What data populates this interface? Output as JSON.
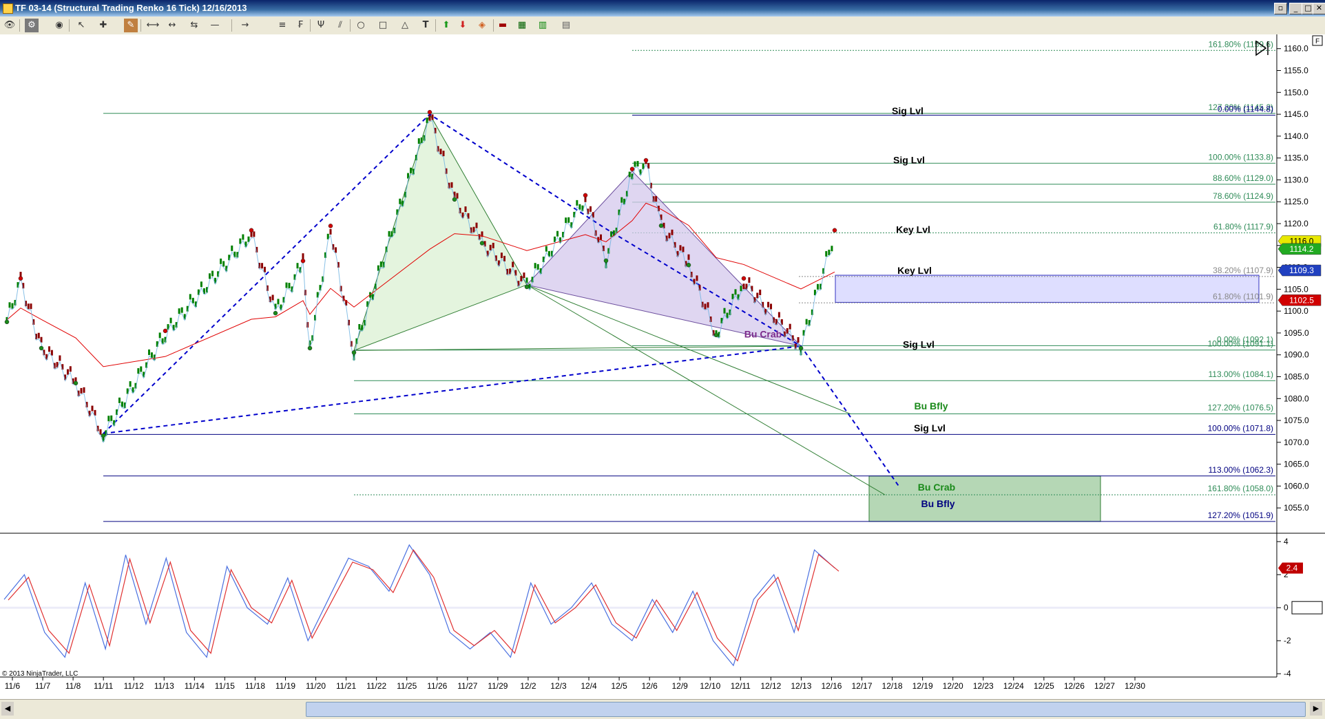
{
  "window": {
    "title": "TF 03-14 (Structural Trading Renko 16 Tick)  12/16/2013"
  },
  "copyright": "© 2013 NinjaTrader, LLC",
  "colors": {
    "bull_bar": "#008000",
    "bear_bar": "#8b0000",
    "pattern_blue": "#0000cc",
    "price_line_red": "#e00000",
    "osc_blue": "#4a70e0",
    "osc_red": "#e03030"
  },
  "chart_data": [
    {
      "type": "line",
      "title": "TF 03-14 (Structural Trading Renko 16 Tick)",
      "ylim": [
        1050,
        1162
      ],
      "y_ticks": [
        1055,
        1060,
        1065,
        1070,
        1075,
        1080,
        1085,
        1090,
        1095,
        1100,
        1105,
        1110,
        1115,
        1120,
        1125,
        1130,
        1135,
        1140,
        1145,
        1150,
        1155,
        1160
      ],
      "x_tick_labels": [
        "11/6",
        "11/7",
        "11/8",
        "11/11",
        "11/12",
        "11/13",
        "11/14",
        "11/15",
        "11/18",
        "11/19",
        "11/20",
        "11/21",
        "11/22",
        "11/25",
        "11/26",
        "11/27",
        "11/29",
        "12/2",
        "12/3",
        "12/4",
        "12/5",
        "12/6",
        "12/9",
        "12/10",
        "12/11",
        "12/12",
        "12/13",
        "12/16",
        "12/17",
        "12/18",
        "12/19",
        "12/20",
        "12/23",
        "12/24",
        "12/25",
        "12/26",
        "12/27",
        "12/30"
      ],
      "series": [
        {
          "values": [
            1098,
            1107,
            1092,
            1084,
            1072,
            1095,
            1118,
            1100,
            1111,
            1092,
            1119,
            1091,
            1145,
            1126,
            1116,
            1106,
            1126,
            1112,
            1132,
            1134,
            1120,
            1111,
            1095,
            1107,
            1092,
            1118
          ]
        }
      ],
      "price_markers": [
        {
          "label": "1116.0",
          "value": 1116.0,
          "color": "#e8e800"
        },
        {
          "label": "1114.2",
          "value": 1114.2,
          "color": "#22aa22"
        },
        {
          "label": "1109.3",
          "value": 1109.3,
          "color": "#2040c0"
        },
        {
          "label": "1102.5",
          "value": 1102.5,
          "color": "#d00000"
        }
      ],
      "levels": [
        {
          "label": "161.80% (1159.6)",
          "value": 1159.6,
          "color": "#2e8b57",
          "style": "dotted"
        },
        {
          "label": "127.20% (1145.2)",
          "value": 1145.2,
          "color": "#2e8b57",
          "style": "solid"
        },
        {
          "label": "0.00% (1144.8)",
          "value": 1144.8,
          "color": "#000080",
          "style": "solid"
        },
        {
          "label": "100.00% (1133.8)",
          "value": 1133.8,
          "color": "#2e8b57",
          "style": "solid"
        },
        {
          "label": "88.60% (1129.0)",
          "value": 1129.0,
          "color": "#2e8b57",
          "style": "solid"
        },
        {
          "label": "78.60% (1124.9)",
          "value": 1124.9,
          "color": "#2e8b57",
          "style": "solid"
        },
        {
          "label": "61.80% (1117.9)",
          "value": 1117.9,
          "color": "#2e8b57",
          "style": "dotted"
        },
        {
          "label": "38.20% (1107.9)",
          "value": 1107.9,
          "color": "#888888",
          "style": "dotted"
        },
        {
          "label": "61.80% (1101.9)",
          "value": 1101.9,
          "color": "#888888",
          "style": "dotted"
        },
        {
          "label": "0.00% (1092.1)",
          "value": 1092.1,
          "color": "#2e8b57",
          "style": "solid"
        },
        {
          "label": "100.00% (1091.1)",
          "value": 1091.1,
          "color": "#2e8b57",
          "style": "solid"
        },
        {
          "label": "113.00% (1084.1)",
          "value": 1084.1,
          "color": "#2e8b57",
          "style": "solid"
        },
        {
          "label": "127.20% (1076.5)",
          "value": 1076.5,
          "color": "#2e8b57",
          "style": "solid"
        },
        {
          "label": "100.00% (1071.8)",
          "value": 1071.8,
          "color": "#000080",
          "style": "solid"
        },
        {
          "label": "113.00% (1062.3)",
          "value": 1062.3,
          "color": "#000080",
          "style": "solid"
        },
        {
          "label": "161.80% (1058.0)",
          "value": 1058.0,
          "color": "#2e8b57",
          "style": "dotted"
        },
        {
          "label": "127.20% (1051.9)",
          "value": 1051.9,
          "color": "#000080",
          "style": "solid"
        }
      ],
      "annotations": [
        {
          "text": "Sig Lvl",
          "value": 1145,
          "color": "#000000"
        },
        {
          "text": "Sig Lvl",
          "value": 1133.8,
          "color": "#000000"
        },
        {
          "text": "Key Lvl",
          "value": 1117.9,
          "color": "#000000"
        },
        {
          "text": "Key Lvl",
          "value": 1108.5,
          "color": "#000000"
        },
        {
          "text": "Sig Lvl",
          "value": 1091.6,
          "color": "#000000"
        },
        {
          "text": "Bu Crab",
          "value": 1094,
          "color": "#7b2b8b"
        },
        {
          "text": "Bu Bfly",
          "value": 1077.5,
          "color": "#1a8a1a"
        },
        {
          "text": "Sig Lvl",
          "value": 1072.5,
          "color": "#000000"
        },
        {
          "text": "Bu Crab",
          "value": 1059.0,
          "color": "#1a8a1a"
        },
        {
          "text": "Bu Bfly",
          "value": 1055.2,
          "color": "#000080"
        }
      ],
      "zones": [
        {
          "name": "key-level-zone",
          "from": 1102.0,
          "to": 1108.2,
          "color": "#d8d8ff"
        },
        {
          "name": "target-zone",
          "from": 1051.9,
          "to": 1062.3,
          "color": "#a8d0a8"
        }
      ]
    },
    {
      "type": "line",
      "title": "",
      "ylim": [
        -4.2,
        4.3
      ],
      "y_ticks": [
        -4,
        -2,
        0,
        2,
        4
      ],
      "current_value_label": "2.4",
      "series": [
        {
          "values": [
            0.5,
            2.0,
            -1.5,
            -3.0,
            1.5,
            -2.5,
            3.2,
            -1.0,
            3.0,
            -1.5,
            -3.0,
            2.5,
            0.0,
            -1.0,
            1.8,
            -2.0,
            0.5,
            3.0,
            2.5,
            1.0,
            3.8,
            2.0,
            -1.5,
            -2.5,
            -1.5,
            -3.0,
            1.5,
            -1.0,
            0.0,
            1.5,
            -1.0,
            -2.0,
            0.5,
            -1.5,
            1.0,
            -2.0,
            -3.5,
            0.5,
            2.0,
            -1.5,
            3.5,
            2.4
          ]
        }
      ]
    }
  ]
}
